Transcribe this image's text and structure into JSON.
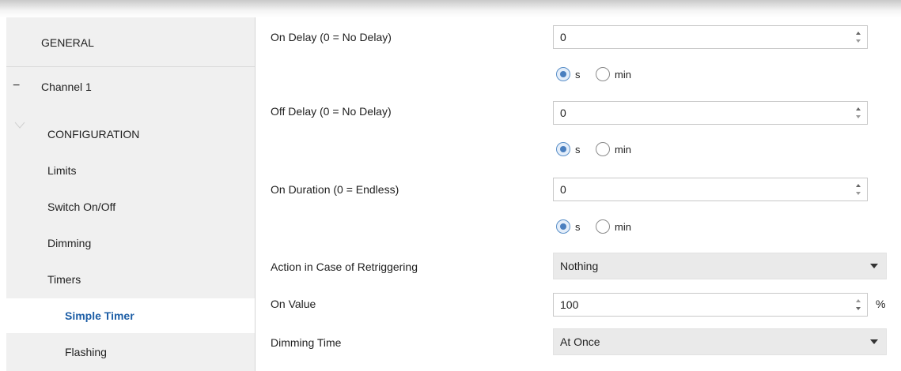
{
  "sidebar": {
    "items": [
      {
        "label": "GENERAL"
      },
      {
        "label": "Channel 1",
        "expander": "−"
      },
      {
        "label": "CONFIGURATION"
      },
      {
        "label": "Limits"
      },
      {
        "label": "Switch On/Off"
      },
      {
        "label": "Dimming"
      },
      {
        "label": "Timers"
      },
      {
        "label": "Simple Timer",
        "selected": true
      },
      {
        "label": "Flashing"
      }
    ]
  },
  "form": {
    "on_delay": {
      "label": "On Delay (0 = No Delay)",
      "value": "0",
      "unit_s": "s",
      "unit_min": "min",
      "selected_unit": "s"
    },
    "off_delay": {
      "label": "Off Delay (0 = No Delay)",
      "value": "0",
      "unit_s": "s",
      "unit_min": "min",
      "selected_unit": "s"
    },
    "on_duration": {
      "label": "On Duration (0 = Endless)",
      "value": "0",
      "unit_s": "s",
      "unit_min": "min",
      "selected_unit": "s"
    },
    "retrigger": {
      "label": "Action in Case of Retriggering",
      "value": "Nothing"
    },
    "on_value": {
      "label": "On Value",
      "value": "100",
      "unit": "%"
    },
    "dimming_time": {
      "label": "Dimming Time",
      "value": "At Once"
    }
  },
  "colors": {
    "selected_text": "#1d5ea6",
    "sidebar_bg": "#f0f0f0",
    "radio_accent": "#4a7fbf"
  },
  "icons": {
    "spin": "spin-up-down-icon",
    "dropdown": "chevron-down-icon"
  }
}
